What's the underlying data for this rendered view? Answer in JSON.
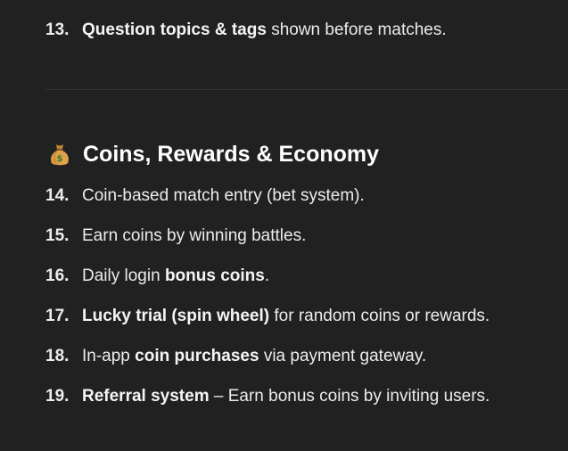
{
  "item_13": {
    "number": "13.",
    "bold": "Question topics & tags",
    "rest": " shown before matches."
  },
  "section": {
    "icon": "money-bag-icon",
    "title": "Coins, Rewards & Economy"
  },
  "items": [
    {
      "number": "14.",
      "pre": "Coin-based match entry (bet system).",
      "bold": "",
      "post": ""
    },
    {
      "number": "15.",
      "pre": "Earn coins by winning battles.",
      "bold": "",
      "post": ""
    },
    {
      "number": "16.",
      "pre": "Daily login ",
      "bold": "bonus coins",
      "post": "."
    },
    {
      "number": "17.",
      "pre": "",
      "bold": "Lucky trial (spin wheel)",
      "post": " for random coins or rewards."
    },
    {
      "number": "18.",
      "pre": "In-app ",
      "bold": "coin purchases",
      "post": " via payment gateway."
    },
    {
      "number": "19.",
      "pre": "",
      "bold": "Referral system",
      "post": " – Earn bonus coins by inviting users."
    }
  ]
}
